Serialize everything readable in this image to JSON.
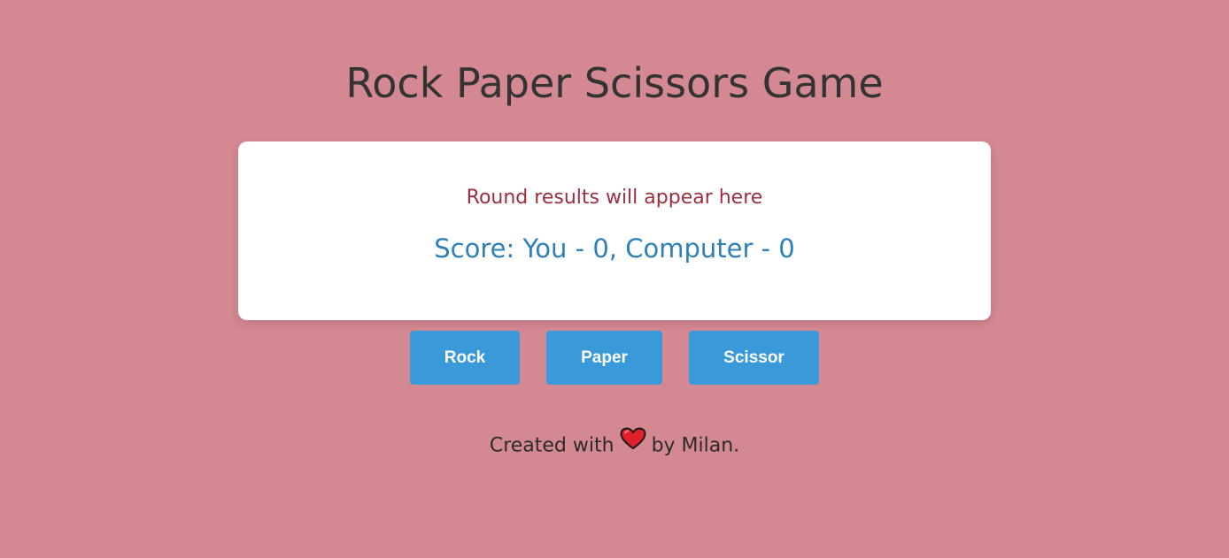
{
  "header": {
    "title": "Rock Paper Scissors Game"
  },
  "result_card": {
    "round_result": "Round results will appear here",
    "score": "Score: You - 0, Computer - 0"
  },
  "controls": {
    "rock_label": "Rock",
    "paper_label": "Paper",
    "scissor_label": "Scissor"
  },
  "footer": {
    "prefix": "Created with",
    "icon": "heart-icon",
    "suffix": "by Milan."
  },
  "colors": {
    "background": "#d48892",
    "card": "#ffffff",
    "round_result_text": "#9b2f3d",
    "score_text": "#2e80b9",
    "button": "#3a9ad9",
    "button_text": "#ffffff",
    "heart": "#e0202a"
  }
}
